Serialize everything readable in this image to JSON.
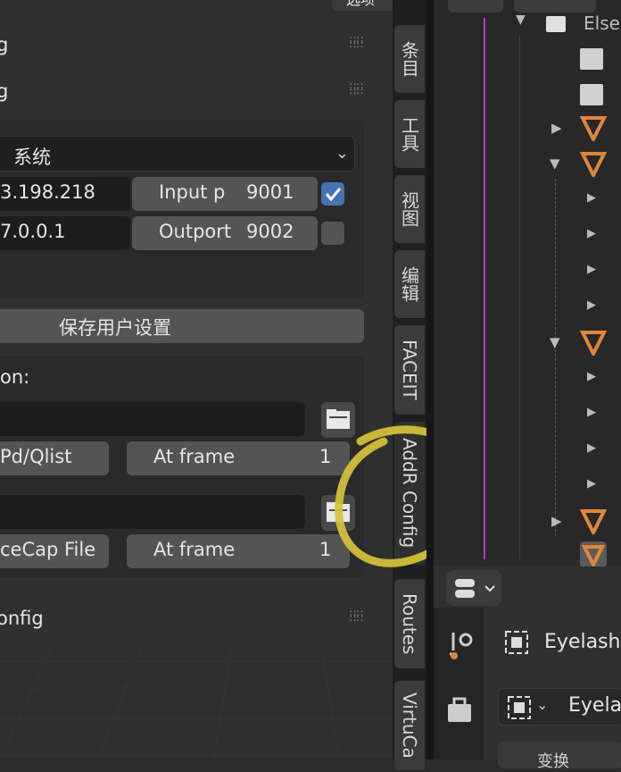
{
  "panel": {
    "header1_title": "g",
    "header2_title": "g",
    "system_select": "系统",
    "ip1": "3.198.218",
    "input_port_label": "Input p",
    "input_port_value": "9001",
    "ip2": "7.0.0.1",
    "outport_label": "Outport",
    "outport_value": "9002",
    "save_button": "保存用户设置",
    "section_label": "on:",
    "pdq_button": "Pd/Qlist",
    "at_frame_label": "At frame",
    "at_frame_value_1": "1",
    "facecap_button": "ceCap File",
    "at_frame_value_2": "1",
    "config_header": "onfig",
    "top_button": "选项"
  },
  "tabs": [
    "条目",
    "工具",
    "视图",
    "编辑",
    "FACEIT",
    "AddR Config",
    "Routes",
    "VirtuCa"
  ],
  "outliner": {
    "top_label": "Else"
  },
  "properties": {
    "object_name": "Eyelashe",
    "data_name": "Eyelas",
    "section": "变换"
  },
  "colors": {
    "accent": "#4772b3",
    "annotation": "#d8c23a",
    "orange": "#e0873a"
  }
}
